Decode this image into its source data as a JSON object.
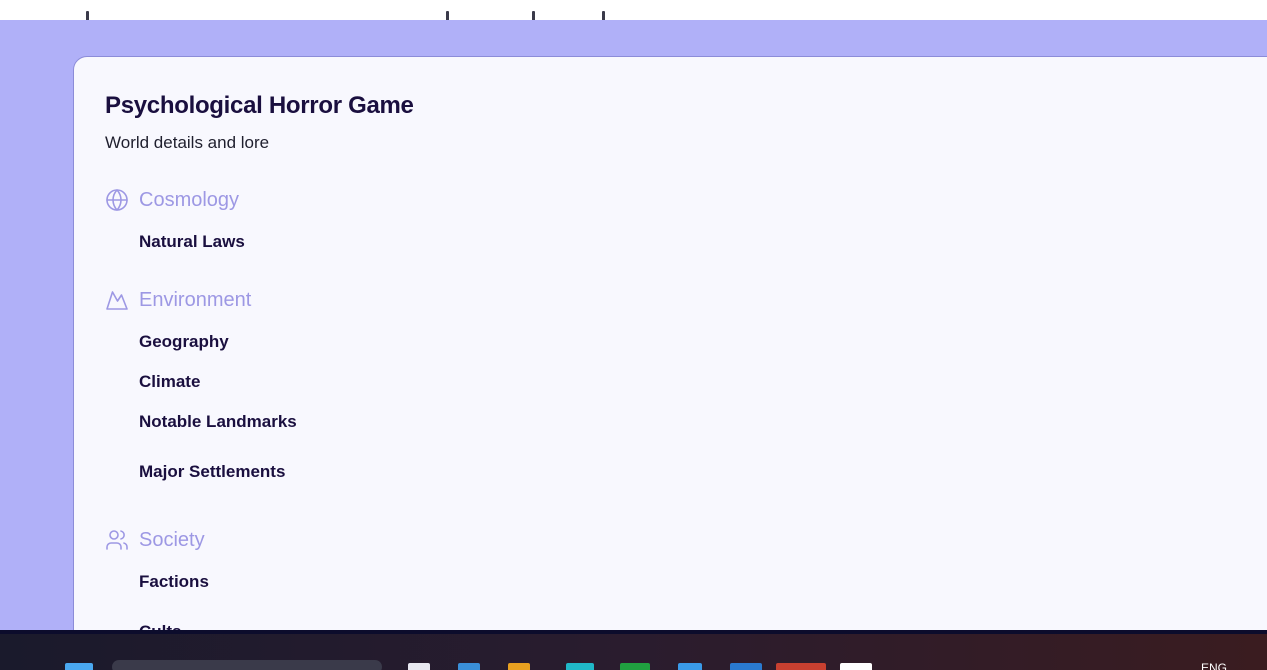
{
  "page": {
    "title": "Psychological Horror Game",
    "subtitle": "World details and lore"
  },
  "sections": [
    {
      "label": "Cosmology",
      "icon": "globe-icon",
      "items": [
        "Natural Laws"
      ]
    },
    {
      "label": "Environment",
      "icon": "mountain-icon",
      "items": [
        "Geography",
        "Climate",
        "Notable Landmarks",
        "Major Settlements"
      ]
    },
    {
      "label": "Society",
      "icon": "users-icon",
      "items": [
        "Factions",
        "Cults"
      ]
    }
  ],
  "taskbar": {
    "tray_text": "ENG"
  },
  "colors": {
    "background": "#b0b0f8",
    "card": "#f8f8fe",
    "section_accent": "#9d98e4",
    "text_dark": "#1a0f3f"
  }
}
